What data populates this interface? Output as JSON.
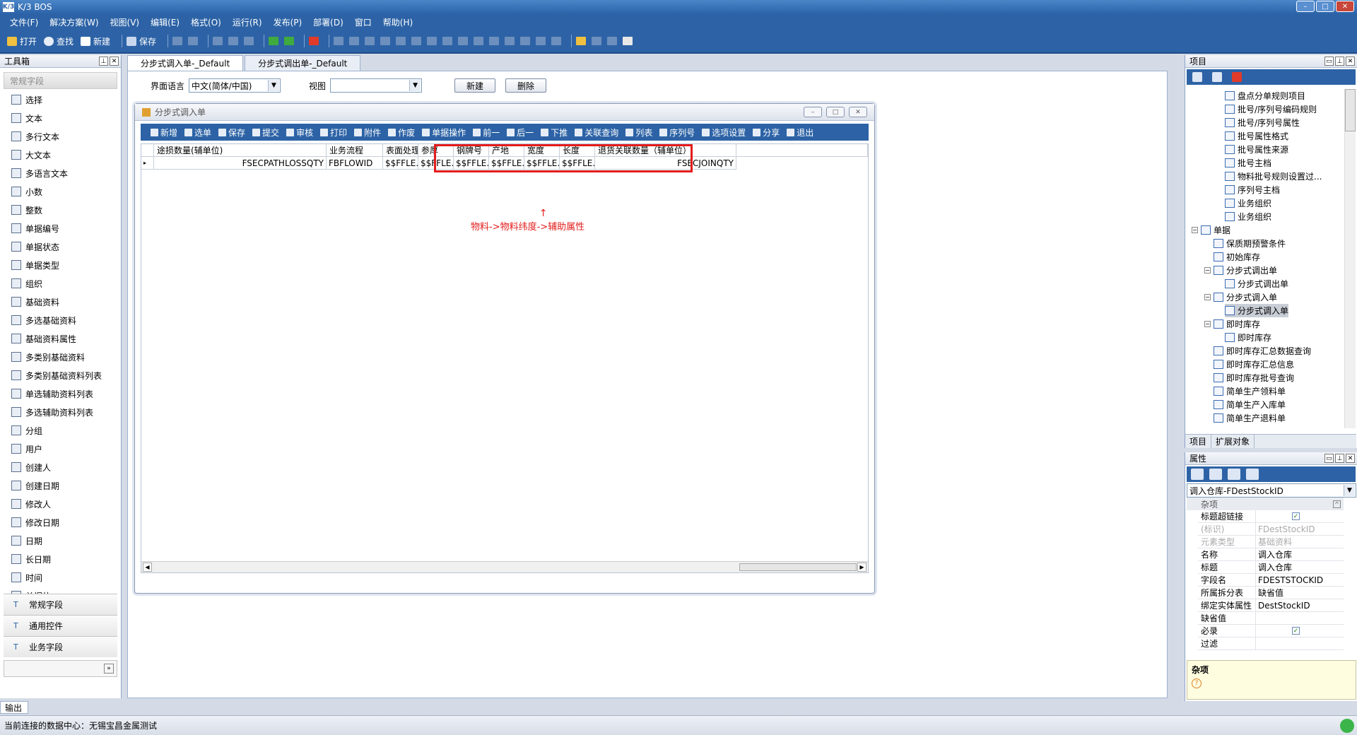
{
  "app": {
    "title": "K/3 BOS",
    "logo_text": "K/3"
  },
  "menu": [
    "文件(F)",
    "解决方案(W)",
    "视图(V)",
    "编辑(E)",
    "格式(O)",
    "运行(R)",
    "发布(P)",
    "部署(D)",
    "窗口",
    "帮助(H)"
  ],
  "toolbar": {
    "open": "打开",
    "find": "查找",
    "new": "新建",
    "save": "保存"
  },
  "toolbox": {
    "title": "工具箱",
    "group": "常规字段",
    "items": [
      "选择",
      "文本",
      "多行文本",
      "大文本",
      "多语言文本",
      "小数",
      "整数",
      "单据编号",
      "单据状态",
      "单据类型",
      "组织",
      "基础资料",
      "多选基础资料",
      "基础资料属性",
      "多类别基础资料",
      "多类别基础资料列表",
      "单选辅助资料列表",
      "多选辅助资料列表",
      "分组",
      "用户",
      "创建人",
      "创建日期",
      "修改人",
      "修改日期",
      "日期",
      "长日期",
      "时间",
      "单据体"
    ],
    "sections": [
      "常规字段",
      "通用控件",
      "业务字段"
    ]
  },
  "doc_tabs": [
    "分步式调入单-_Default",
    "分步式调出单-_Default"
  ],
  "langbar": {
    "lang_label": "界面语言",
    "lang_value": "中文(简体/中国)",
    "view_label": "视图",
    "new_btn": "新建",
    "delete_btn": "删除"
  },
  "form": {
    "title": "分步式调入单",
    "toolbar": [
      "新增",
      "选单",
      "保存",
      "提交",
      "审核",
      "打印",
      "附件",
      "作废",
      "单据操作",
      "前一",
      "后一",
      "下推",
      "关联查询",
      "列表",
      "序列号",
      "选项设置",
      "分享",
      "退出"
    ],
    "columns": [
      "途损数量(辅单位)",
      "业务流程",
      "表面处理",
      "参厚",
      "钢牌号",
      "产地",
      "宽度",
      "长度",
      "退货关联数量（辅单位）"
    ],
    "row": [
      "FSECPATHLOSSQTY",
      "FBFLOWID",
      "$$FFLE...",
      "$$FFLE...",
      "$$FFLE...",
      "$$FFLE...",
      "$$FFLE...",
      "$$FFLE...",
      "FSECJOINQTY"
    ],
    "annotation": "物料->物料纬度->辅助属性",
    "highlight_color": "#e31c1c"
  },
  "project": {
    "title": "项目",
    "tree": [
      {
        "label": "盘点分单规则项目",
        "level": 3
      },
      {
        "label": "批号/序列号编码规则",
        "level": 3
      },
      {
        "label": "批号/序列号属性",
        "level": 3
      },
      {
        "label": "批号属性格式",
        "level": 3
      },
      {
        "label": "批号属性来源",
        "level": 3
      },
      {
        "label": "批号主档",
        "level": 3
      },
      {
        "label": "物料批号规则设置过...",
        "level": 3
      },
      {
        "label": "序列号主档",
        "level": 3
      },
      {
        "label": "业务组织",
        "level": 3
      },
      {
        "label": "业务组织",
        "level": 3
      },
      {
        "label": "单据",
        "level": 1,
        "expander": "−"
      },
      {
        "label": "保质期预警条件",
        "level": 2
      },
      {
        "label": "初始库存",
        "level": 2
      },
      {
        "label": "分步式调出单",
        "level": 2,
        "expander": "−"
      },
      {
        "label": "分步式调出单",
        "level": 3
      },
      {
        "label": "分步式调入单",
        "level": 2,
        "expander": "−"
      },
      {
        "label": "分步式调入单",
        "level": 3,
        "selected": true
      },
      {
        "label": "即时库存",
        "level": 2,
        "expander": "−"
      },
      {
        "label": "即时库存",
        "level": 3
      },
      {
        "label": "即时库存汇总数据查询",
        "level": 2
      },
      {
        "label": "即时库存汇总信息",
        "level": 2
      },
      {
        "label": "即时库存批号查询",
        "level": 2
      },
      {
        "label": "简单生产领料单",
        "level": 2
      },
      {
        "label": "简单生产入库单",
        "level": 2
      },
      {
        "label": "简单生产退料单",
        "level": 2
      }
    ],
    "tabs": [
      "项目",
      "扩展对象"
    ]
  },
  "properties": {
    "title": "属性",
    "selector": "调入仓库-FDestStockID",
    "category": "杂项",
    "rows": [
      {
        "name": "标题超链接",
        "value": "",
        "checkbox": true
      },
      {
        "name": "(标识)",
        "value": "FDestStockID",
        "disabled": true
      },
      {
        "name": "元素类型",
        "value": "基础资料",
        "disabled": true
      },
      {
        "name": "名称",
        "value": "调入仓库"
      },
      {
        "name": "标题",
        "value": "调入仓库"
      },
      {
        "name": "字段名",
        "value": "FDESTSTOCKID"
      },
      {
        "name": "所属拆分表",
        "value": "缺省值"
      },
      {
        "name": "绑定实体属性",
        "value": "DestStockID"
      },
      {
        "name": "缺省值",
        "value": ""
      },
      {
        "name": "必录",
        "value": "",
        "checkbox": true
      },
      {
        "name": "过滤",
        "value": ""
      }
    ],
    "desc_title": "杂项"
  },
  "output_tab": "输出",
  "status": "当前连接的数据中心：无锡宝昌金属测试"
}
